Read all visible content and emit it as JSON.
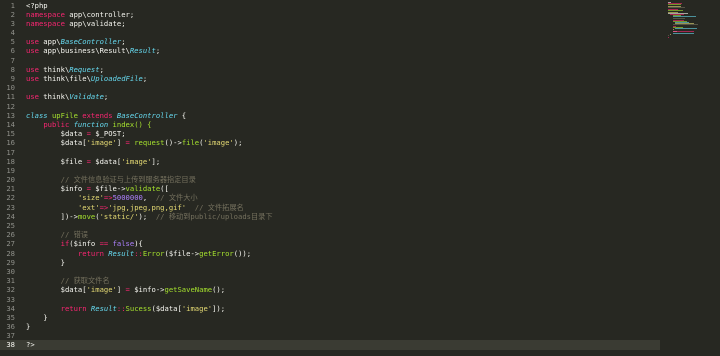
{
  "editor": {
    "theme_colors": {
      "background": "#272822",
      "keyword": "#f92672",
      "storage": "#66d9ef",
      "function": "#a6e22e",
      "string": "#e6db74",
      "number": "#ae81ff",
      "comment": "#75715e",
      "text": "#f8f8f2"
    },
    "active_line": 38,
    "lines": [
      {
        "n": "1",
        "t": [
          "<?php"
        ]
      },
      {
        "n": "2",
        "t": [
          "namespace",
          " app\\controller;"
        ]
      },
      {
        "n": "3",
        "t": [
          "namespace",
          " app\\validate;"
        ]
      },
      {
        "n": "4",
        "t": []
      },
      {
        "n": "5",
        "t": [
          "use",
          " app\\",
          "BaseController",
          ";"
        ]
      },
      {
        "n": "6",
        "t": [
          "use",
          " app\\business\\Result\\",
          "Result",
          ";"
        ]
      },
      {
        "n": "7",
        "t": []
      },
      {
        "n": "8",
        "t": [
          "use",
          " think\\",
          "Request",
          ";"
        ]
      },
      {
        "n": "9",
        "t": [
          "use",
          " think\\file\\",
          "UploadedFile",
          ";"
        ]
      },
      {
        "n": "10",
        "t": []
      },
      {
        "n": "11",
        "t": [
          "use",
          " think\\",
          "Validate",
          ";"
        ]
      },
      {
        "n": "12",
        "t": []
      },
      {
        "n": "13",
        "t": [
          "class",
          " upFile ",
          "extends",
          " ",
          "BaseController",
          " {"
        ]
      },
      {
        "n": "14",
        "t": [
          "    ",
          "public",
          " ",
          "function",
          " index() {"
        ]
      },
      {
        "n": "15",
        "t": [
          "        $data ",
          "=",
          " $_POST;"
        ]
      },
      {
        "n": "16",
        "t": [
          "        $data[",
          "'image'",
          "] ",
          "=",
          " ",
          "request",
          "()->",
          "file",
          "(",
          "'image'",
          ");"
        ]
      },
      {
        "n": "17",
        "t": []
      },
      {
        "n": "18",
        "t": [
          "        $file ",
          "=",
          " $data[",
          "'image'",
          "];"
        ]
      },
      {
        "n": "19",
        "t": []
      },
      {
        "n": "20",
        "t": [
          "        ",
          "// 文件信息验证与上传到服务器指定目录"
        ]
      },
      {
        "n": "21",
        "t": [
          "        $info ",
          "=",
          " $file->",
          "validate",
          "(["
        ]
      },
      {
        "n": "22",
        "t": [
          "            ",
          "'size'",
          "=>",
          "5000000",
          ",  ",
          "// 文件大小"
        ]
      },
      {
        "n": "23",
        "t": [
          "            ",
          "'ext'",
          "=>",
          "'jpg,jpeg,png,gif'",
          "  ",
          "// 文件拓展名"
        ]
      },
      {
        "n": "24",
        "t": [
          "        ])->",
          "move",
          "(",
          "'static/'",
          ");  ",
          "// 移动到public/uploads目录下"
        ]
      },
      {
        "n": "25",
        "t": []
      },
      {
        "n": "26",
        "t": [
          "        ",
          "// 错误"
        ]
      },
      {
        "n": "27",
        "t": [
          "        ",
          "if",
          "($info ",
          "==",
          " ",
          "false",
          "){"
        ]
      },
      {
        "n": "28",
        "t": [
          "            ",
          "return",
          " ",
          "Result",
          "::",
          "Error",
          "($file->",
          "getError",
          "());"
        ]
      },
      {
        "n": "29",
        "t": [
          "        }"
        ]
      },
      {
        "n": "30",
        "t": []
      },
      {
        "n": "31",
        "t": [
          "        ",
          "// 获取文件名"
        ]
      },
      {
        "n": "32",
        "t": [
          "        $data[",
          "'image'",
          "] ",
          "=",
          " $info->",
          "getSaveName",
          "();"
        ]
      },
      {
        "n": "33",
        "t": []
      },
      {
        "n": "34",
        "t": [
          "        ",
          "return",
          " ",
          "Result",
          "::",
          "Sucess",
          "($data[",
          "'image'",
          "]);"
        ]
      },
      {
        "n": "35",
        "t": [
          "    }"
        ]
      },
      {
        "n": "36",
        "t": [
          "}"
        ]
      },
      {
        "n": "37",
        "t": []
      },
      {
        "n": "38",
        "t": [
          "?>"
        ]
      }
    ]
  },
  "minimap": {
    "label": "minimap"
  }
}
